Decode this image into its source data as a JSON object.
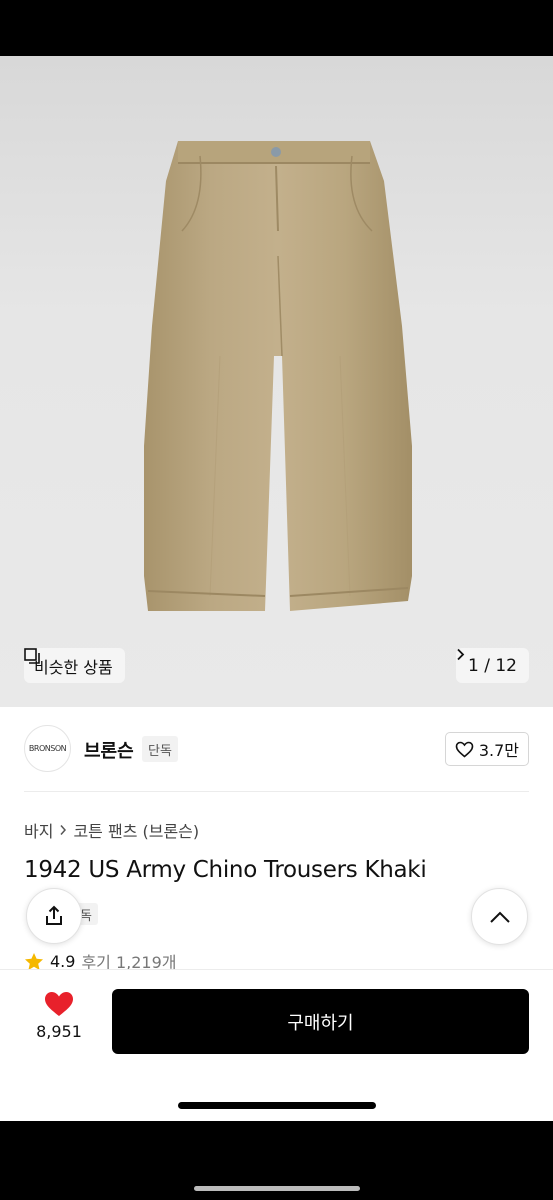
{
  "hero": {
    "similar_label": "비슷한 상품",
    "pager_text": "1 / 12"
  },
  "brand": {
    "logo_text": "BRONSON",
    "name": "브론슨",
    "badge": "단독",
    "likes": "3.7만"
  },
  "breadcrumb": {
    "category": "바지",
    "subcategory": "코튼 팬츠 (브론슨)"
  },
  "product": {
    "title": "1942 US Army Chino Trousers Khaki",
    "excl_badge": "단독",
    "rating": "4.9",
    "reviews": "후기 1,219개"
  },
  "bottom": {
    "heart_count": "8,951",
    "buy_label": "구매하기"
  },
  "colors": {
    "accent": "#e8212b",
    "khaki": "#b8a57e",
    "star": "#f5b800"
  },
  "icons": [
    "similar-icon",
    "chevron-right-icon",
    "heart-outline-icon",
    "share-icon",
    "chevron-up-icon",
    "star-icon",
    "heart-filled-icon"
  ]
}
